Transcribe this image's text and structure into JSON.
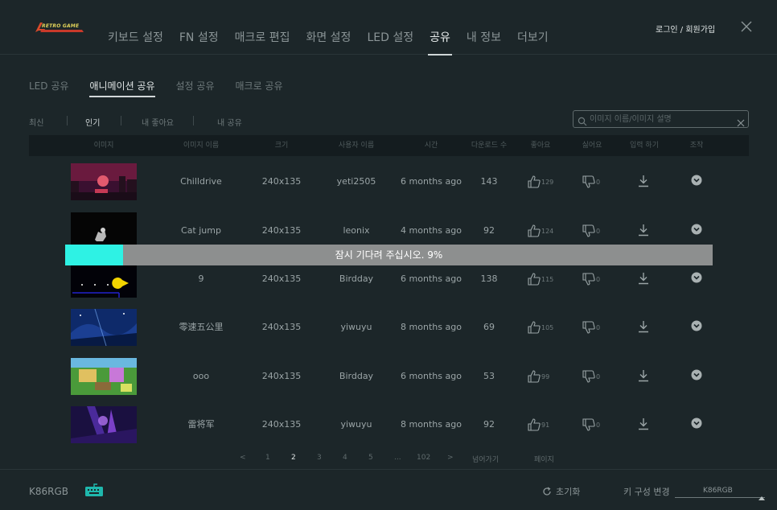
{
  "header": {
    "logo_text": "RETRO GAME",
    "nav": [
      "키보드 설정",
      "FN 설정",
      "매크로 편집",
      "화면 설정",
      "LED 설정",
      "공유",
      "내 정보",
      "더보기"
    ],
    "active_nav": "공유",
    "login_label": "로그인 / 회원가입"
  },
  "share_tabs": [
    "LED 공유",
    "애니메이션 공유",
    "설정 공유",
    "매크로 공유"
  ],
  "active_share_tab": "애니메이션 공유",
  "filters": [
    "최신",
    "인기",
    "내 좋아요",
    "내 공유"
  ],
  "active_filter": "인기",
  "search": {
    "placeholder": "이미지 이름/이미지 설명",
    "value": ""
  },
  "table": {
    "columns": [
      "이미지",
      "이미지 이름",
      "크기",
      "사용자 이름",
      "시간",
      "다운로드 수",
      "좋아요",
      "싫어요",
      "입력 하기",
      "조작"
    ],
    "rows": [
      {
        "name": "Chilldrive",
        "size": "240x135",
        "user": "yeti2505",
        "time": "6 months ago",
        "downloads": "143",
        "likes": "129",
        "dislikes": "0",
        "thumb": "sunset-city"
      },
      {
        "name": "Cat jump",
        "size": "240x135",
        "user": "leonix",
        "time": "4 months ago",
        "downloads": "92",
        "likes": "124",
        "dislikes": "0",
        "thumb": "cat"
      },
      {
        "name": "9",
        "size": "240x135",
        "user": "Birdday",
        "time": "6 months ago",
        "downloads": "138",
        "likes": "115",
        "dislikes": "0",
        "thumb": "pacman"
      },
      {
        "name": "零速五公里",
        "size": "240x135",
        "user": "yiwuyu",
        "time": "8 months ago",
        "downloads": "69",
        "likes": "105",
        "dislikes": "0",
        "thumb": "night-sky"
      },
      {
        "name": "ooo",
        "size": "240x135",
        "user": "Birdday",
        "time": "6 months ago",
        "downloads": "53",
        "likes": "99",
        "dislikes": "0",
        "thumb": "pixel-yard"
      },
      {
        "name": "雷将军",
        "size": "240x135",
        "user": "yiwuyu",
        "time": "8 months ago",
        "downloads": "92",
        "likes": "91",
        "dislikes": "0",
        "thumb": "purple-warrior"
      }
    ]
  },
  "progress": {
    "text": "잠시 기다려 주십시오. 9%",
    "value": 0.09,
    "fill_color": "#2ef2e4",
    "track_color": "#8d8f8f"
  },
  "pagination": {
    "prev": "<",
    "pages": [
      "1",
      "2",
      "3",
      "4",
      "5",
      "...",
      "102"
    ],
    "current": "2",
    "next": ">",
    "goto_label": "넘어가기",
    "page_label": "페이지"
  },
  "footer": {
    "model": "K86RGB",
    "reset_label": "초기화",
    "key_config_label": "키 구성 변경",
    "key_config_value": "K86RGB"
  },
  "colors": {
    "accent": "#2ef2e4",
    "background": "#1c2629",
    "header_row": "#141c1f",
    "keyboard_icon": "#1fb8ad"
  }
}
